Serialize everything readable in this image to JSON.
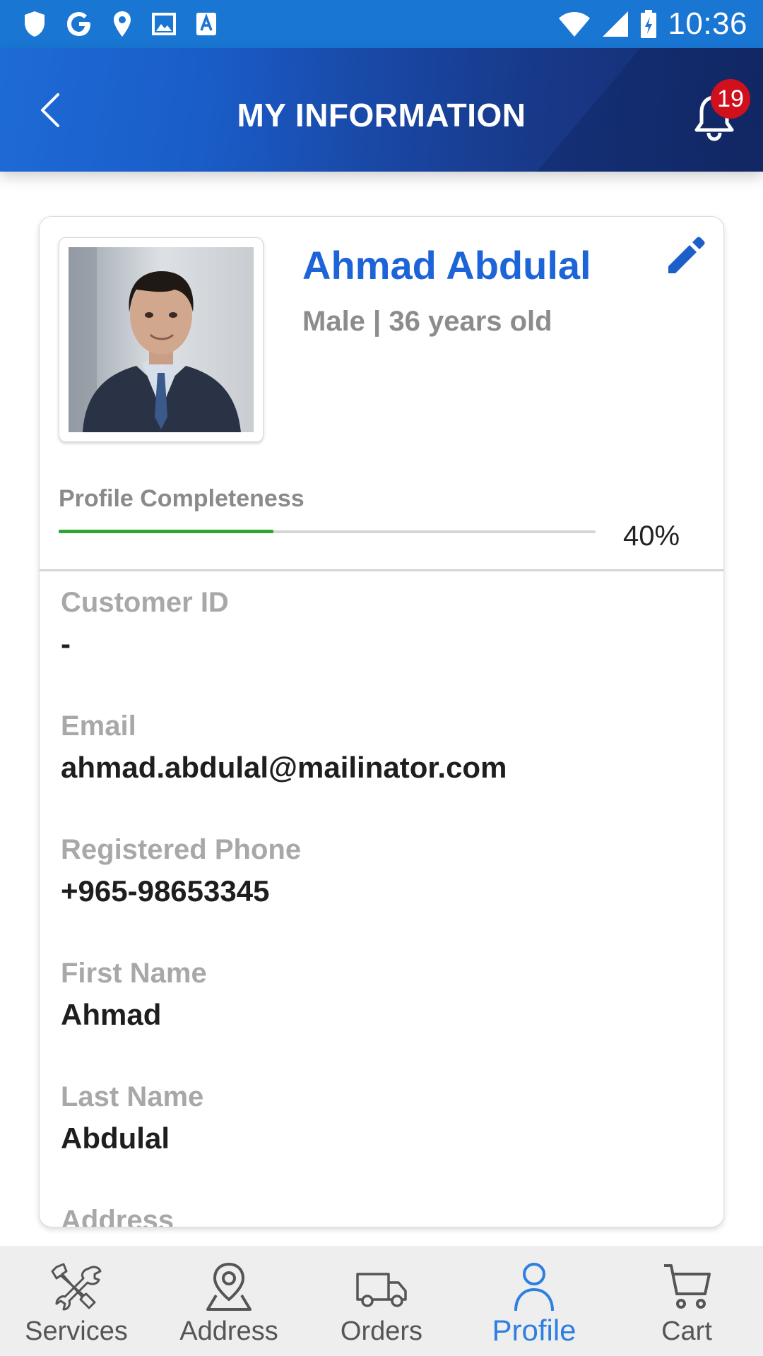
{
  "status_bar": {
    "time": "10:36",
    "left_icons": [
      "shield-icon",
      "google-icon",
      "location-pin-icon",
      "image-icon",
      "font-a-icon"
    ],
    "right_icons": [
      "wifi-icon",
      "cell-signal-icon",
      "battery-charging-icon"
    ],
    "color": "#1976d2"
  },
  "header": {
    "title": "MY INFORMATION",
    "notification_count": "19"
  },
  "profile": {
    "name": "Ahmad Abdulal",
    "meta": "Male | 36 years old",
    "completeness_label": "Profile Completeness",
    "completeness_text": "40%",
    "completeness_fraction": 0.4
  },
  "fields": [
    {
      "label": "Customer ID",
      "value": "-"
    },
    {
      "label": "Email",
      "value": "ahmad.abdulal@mailinator.com"
    },
    {
      "label": "Registered Phone",
      "value": "+965-98653345"
    },
    {
      "label": "First Name",
      "value": "Ahmad"
    },
    {
      "label": "Last Name",
      "value": "Abdulal"
    },
    {
      "label": "Address",
      "value": ""
    }
  ],
  "bottom_nav": [
    {
      "label": "Services",
      "icon": "tools-icon",
      "active": false
    },
    {
      "label": "Address",
      "icon": "map-pin-icon",
      "active": false
    },
    {
      "label": "Orders",
      "icon": "truck-icon",
      "active": false
    },
    {
      "label": "Profile",
      "icon": "person-icon",
      "active": true
    },
    {
      "label": "Cart",
      "icon": "cart-icon",
      "active": false
    }
  ],
  "colors": {
    "accent": "#1d64d8",
    "progress": "#2ea52e",
    "badge": "#d0101c",
    "active_nav": "#2d7fe0"
  }
}
